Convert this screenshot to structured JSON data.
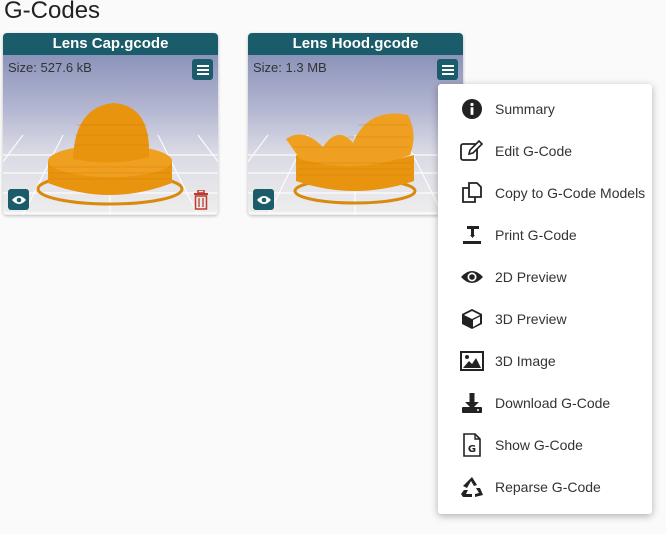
{
  "page": {
    "title": "G-Codes"
  },
  "cards": [
    {
      "title": "Lens Cap.gcode",
      "size": "Size: 527.6 kB"
    },
    {
      "title": "Lens Hood.gcode",
      "size": "Size: 1.3 MB"
    }
  ],
  "colors": {
    "header": "#1b5c6b",
    "model": "#e8940f",
    "delete": "#c0392b"
  },
  "context_menu": {
    "items": [
      {
        "label": "Summary",
        "icon": "info-icon"
      },
      {
        "label": "Edit G-Code",
        "icon": "edit-icon"
      },
      {
        "label": "Copy to G-Code Models",
        "icon": "copy-icon"
      },
      {
        "label": "Print G-Code",
        "icon": "print-icon"
      },
      {
        "label": "2D Preview",
        "icon": "eye-icon"
      },
      {
        "label": "3D Preview",
        "icon": "cube-icon"
      },
      {
        "label": "3D Image",
        "icon": "image-icon"
      },
      {
        "label": "Download G-Code",
        "icon": "download-icon"
      },
      {
        "label": "Show G-Code",
        "icon": "file-g-icon"
      },
      {
        "label": "Reparse G-Code",
        "icon": "recycle-icon"
      }
    ]
  }
}
